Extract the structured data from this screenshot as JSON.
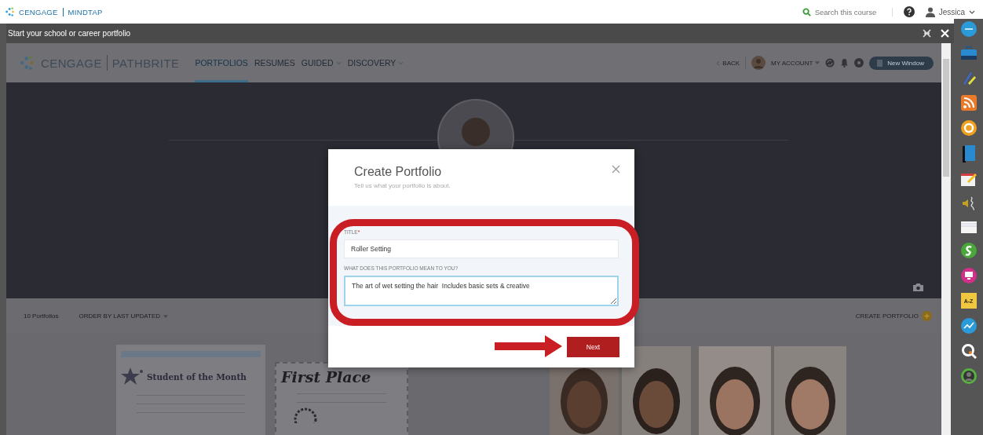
{
  "app_bar": {
    "logo": "CENGAGE",
    "product": "MINDTAP",
    "search": {
      "placeholder": "Search this course"
    },
    "user": "Jessica"
  },
  "window": {
    "title": "Start your school or career portfolio"
  },
  "pathbrite": {
    "logo": "CENGAGE",
    "product": "PATHBRITE",
    "back": "BACK",
    "account": "MY ACCOUNT",
    "new_window": "New Window",
    "nav": [
      {
        "label": "PORTFOLIOS",
        "selected": true,
        "dropdown": false
      },
      {
        "label": "RESUMES",
        "selected": false,
        "dropdown": false
      },
      {
        "label": "GUIDED",
        "selected": false,
        "dropdown": true
      },
      {
        "label": "DISCOVERY",
        "selected": false,
        "dropdown": true
      }
    ]
  },
  "toolbar": {
    "count": "10 Portfolios",
    "sort": "ORDER BY LAST UPDATED",
    "create": "CREATE PORTFOLIO"
  },
  "gallery": [
    {
      "kind": "certificate",
      "title": "Student of the Month"
    },
    {
      "kind": "award",
      "title": "First Place"
    },
    {
      "kind": "picture"
    }
  ],
  "dialog": {
    "title": "Create Portfolio",
    "subtitle": "Tell us what your portfolio is about.",
    "next": "Next",
    "fields": [
      {
        "label": "TITLE",
        "required_mark": "*",
        "value": "Roller Setting",
        "focused": false,
        "kind": "input"
      },
      {
        "label": "WHAT DOES THIS PORTFOLIO MEAN TO YOU?",
        "value": "The art of wet setting the hair  Includes basic sets & creative",
        "focused": true,
        "kind": "textarea"
      }
    ]
  },
  "dock": [
    {
      "kind": "badge"
    },
    {
      "kind": "briefcase"
    },
    {
      "kind": "pencil"
    },
    {
      "kind": "rss"
    },
    {
      "kind": "ring"
    },
    {
      "kind": "book"
    },
    {
      "kind": "note"
    },
    {
      "kind": "speaker"
    },
    {
      "kind": "card"
    },
    {
      "kind": "sphere"
    },
    {
      "kind": "monitor"
    },
    {
      "kind": "tile",
      "label": "A-Z"
    },
    {
      "kind": "chart"
    },
    {
      "kind": "search"
    },
    {
      "kind": "person"
    }
  ]
}
